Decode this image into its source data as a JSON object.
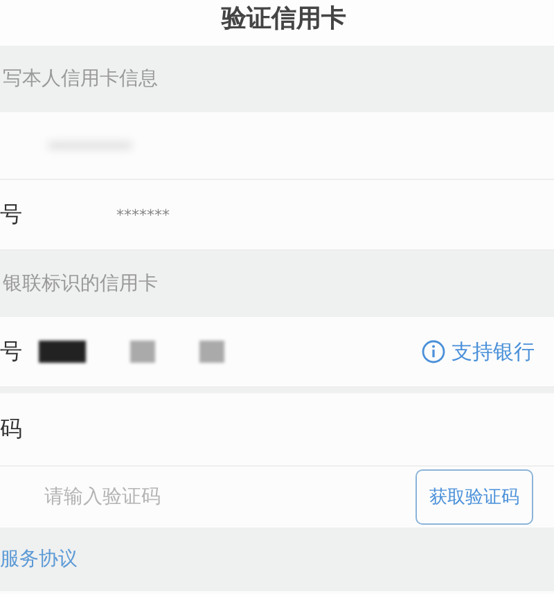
{
  "title": "验证信用卡",
  "sections": [
    {
      "header": "写本人信用卡信息",
      "rows": [
        {
          "kind": "blank"
        },
        {
          "kind": "masked",
          "label": "号",
          "value": "*******"
        }
      ]
    },
    {
      "header": "银联标识的信用卡",
      "rows": [
        {
          "kind": "card",
          "label": "号",
          "link": "支持银行"
        },
        {
          "kind": "label",
          "label": "码"
        },
        {
          "kind": "code",
          "placeholder": "请输入验证码",
          "button": "获取验证码"
        }
      ]
    }
  ],
  "footer_link": "服务协议"
}
